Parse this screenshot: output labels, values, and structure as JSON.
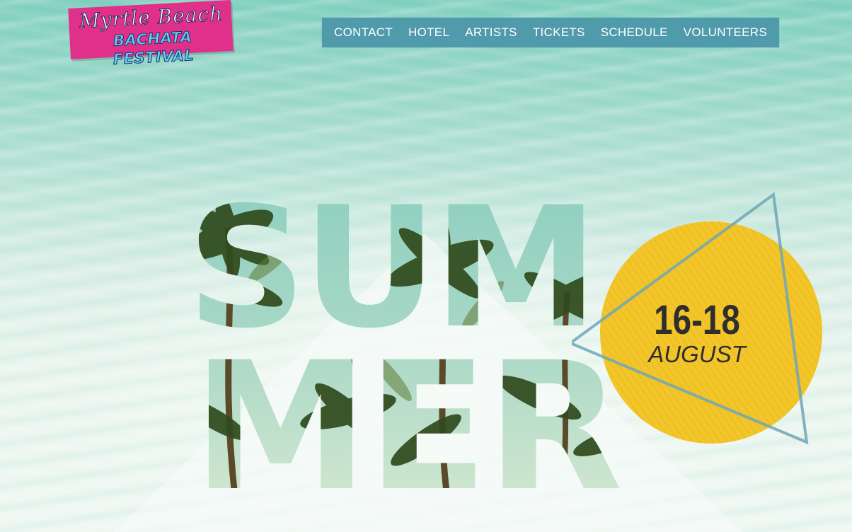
{
  "logo": {
    "script_text": "Myrtle Beach",
    "block_text": "BACHATA FESTIVAL",
    "bg_color": "#e0308a",
    "script_color": "#ffffff",
    "block_color": "#5fd3f0"
  },
  "nav": {
    "bg_color": "#4f9aab",
    "items": [
      "CONTACT",
      "HOTEL",
      "ARTISTS",
      "TICKETS",
      "SCHEDULE",
      "VOLUNTEERS"
    ]
  },
  "hero": {
    "line1": "SUM",
    "line2": "MER",
    "fill_image": "palm-trees-photo",
    "date_range": "16-18",
    "month": "AUGUST",
    "badge_color": "#f2c52a",
    "triangle_color": "#6fa6b6"
  },
  "background": {
    "image": "ocean-water-photo",
    "colors": [
      "#7ecfbe",
      "#bfe5d9",
      "#eef7f2"
    ]
  }
}
